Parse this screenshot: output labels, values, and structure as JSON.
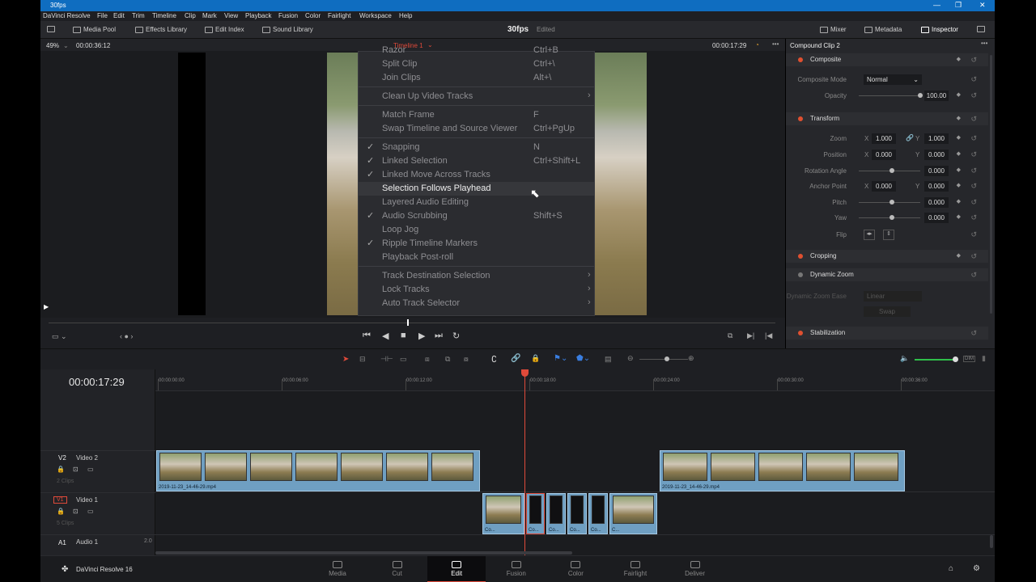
{
  "window": {
    "title": "30fps",
    "controls": [
      "—",
      "❐",
      "✕"
    ]
  },
  "menubar": [
    "DaVinci Resolve",
    "File",
    "Edit",
    "Trim",
    "Timeline",
    "Clip",
    "Mark",
    "View",
    "Playback",
    "Fusion",
    "Color",
    "Fairlight",
    "Workspace",
    "Help"
  ],
  "toolbar": {
    "media_pool": "Media Pool",
    "effects_library": "Effects Library",
    "edit_index": "Edit Index",
    "sound_library": "Sound Library",
    "project": "30fps",
    "project_status": "Edited",
    "mixer": "Mixer",
    "metadata": "Metadata",
    "inspector": "Inspector"
  },
  "viewer": {
    "zoom": "49%",
    "source_tc": "00:00:36:12",
    "timeline_name": "Timeline 1",
    "record_tc": "00:00:17:29"
  },
  "context_menu": [
    {
      "label": "Razor",
      "key": "Ctrl+B",
      "check": false,
      "sub": false
    },
    {
      "label": "Split Clip",
      "key": "Ctrl+\\",
      "check": false,
      "sub": false
    },
    {
      "label": "Join Clips",
      "key": "Alt+\\",
      "check": false,
      "sub": false
    },
    {
      "sep": true
    },
    {
      "label": "Clean Up Video Tracks",
      "key": "",
      "check": false,
      "sub": true
    },
    {
      "sep": true
    },
    {
      "label": "Match Frame",
      "key": "F",
      "check": false,
      "sub": false
    },
    {
      "label": "Swap Timeline and Source Viewer",
      "key": "Ctrl+PgUp",
      "check": false,
      "sub": false
    },
    {
      "sep": true
    },
    {
      "label": "Snapping",
      "key": "N",
      "check": true,
      "sub": false
    },
    {
      "label": "Linked Selection",
      "key": "Ctrl+Shift+L",
      "check": true,
      "sub": false
    },
    {
      "label": "Linked Move Across Tracks",
      "key": "",
      "check": true,
      "sub": false
    },
    {
      "label": "Selection Follows Playhead",
      "key": "",
      "check": false,
      "sub": false,
      "highlight": true
    },
    {
      "label": "Layered Audio Editing",
      "key": "",
      "check": false,
      "sub": false
    },
    {
      "label": "Audio Scrubbing",
      "key": "Shift+S",
      "check": true,
      "sub": false
    },
    {
      "label": "Loop Jog",
      "key": "",
      "check": false,
      "sub": false
    },
    {
      "label": "Ripple Timeline Markers",
      "key": "",
      "check": true,
      "sub": false
    },
    {
      "label": "Playback Post-roll",
      "key": "",
      "check": false,
      "sub": false
    },
    {
      "sep": true
    },
    {
      "label": "Track Destination Selection",
      "key": "",
      "check": false,
      "sub": true
    },
    {
      "label": "Lock Tracks",
      "key": "",
      "check": false,
      "sub": true
    },
    {
      "label": "Auto Track Selector",
      "key": "",
      "check": false,
      "sub": true
    }
  ],
  "inspector": {
    "title": "Compound Clip 2",
    "composite": {
      "header": "Composite",
      "mode_label": "Composite Mode",
      "mode": "Normal",
      "opacity_label": "Opacity",
      "opacity": "100.00",
      "opacity_level": 1.0
    },
    "transform": {
      "header": "Transform",
      "zoom_label": "Zoom",
      "zoom_x": "1.000",
      "zoom_y": "1.000",
      "position_label": "Position",
      "pos_x": "0.000",
      "pos_y": "0.000",
      "rotation_label": "Rotation Angle",
      "rotation": "0.000",
      "anchor_label": "Anchor Point",
      "anchor_x": "0.000",
      "anchor_y": "0.000",
      "pitch_label": "Pitch",
      "pitch": "0.000",
      "yaw_label": "Yaw",
      "yaw": "0.000",
      "flip_label": "Flip",
      "x": "X",
      "y": "Y"
    },
    "cropping": "Cropping",
    "dynamic_zoom": {
      "header": "Dynamic Zoom",
      "ease_label": "Dynamic Zoom Ease",
      "ease": "Linear",
      "swap": "Swap"
    },
    "stabilization": "Stabilization"
  },
  "timeline": {
    "timecode": "00:00:17:29",
    "ruler": [
      "00:00:00:00",
      "00:00:06:00",
      "00:00:12:00",
      "00:00:18:00",
      "00:00:24:00",
      "00:00:30:00",
      "00:00:36:00"
    ],
    "tracks": [
      {
        "id": "V2",
        "name": "Video 2",
        "count": "2 Clips"
      },
      {
        "id": "V1",
        "name": "Video 1",
        "count": "5 Clips"
      },
      {
        "id": "A1",
        "name": "Audio 1",
        "channels": "2.0"
      }
    ],
    "v2_clip_name": "2019-11-23_14-46-29.mp4",
    "v1_clip_label": "Co...",
    "v1_clip_last": "C..."
  },
  "pages": [
    {
      "label": "Media",
      "active": false
    },
    {
      "label": "Cut",
      "active": false
    },
    {
      "label": "Edit",
      "active": true
    },
    {
      "label": "Fusion",
      "active": false
    },
    {
      "label": "Color",
      "active": false
    },
    {
      "label": "Fairlight",
      "active": false
    },
    {
      "label": "Deliver",
      "active": false
    }
  ],
  "brand": "DaVinci Resolve 16",
  "colors": {
    "accent": "#e04a3a",
    "clip": "#6f9fc2",
    "titlebar": "#0f6dc0"
  }
}
